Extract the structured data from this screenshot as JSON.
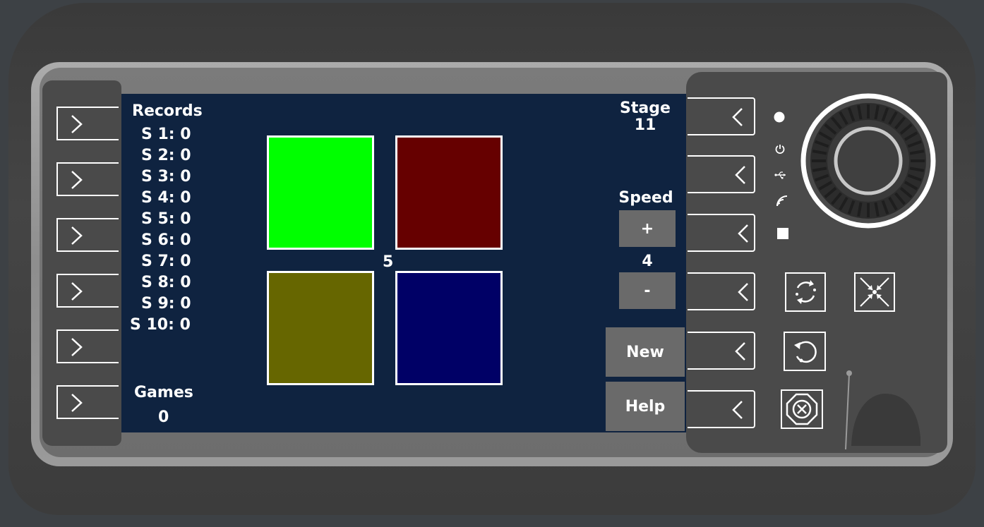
{
  "records": {
    "title": "Records",
    "items": [
      "S 1: 0",
      "S 2: 0",
      "S 3: 0",
      "S 4: 0",
      "S 5: 0",
      "S 6: 0",
      "S 7: 0",
      "S 8: 0",
      "S 9: 0",
      "S 10: 0"
    ]
  },
  "games": {
    "title": "Games",
    "value": "0"
  },
  "board": {
    "center_value": "5",
    "tiles": [
      {
        "name": "green",
        "color": "#00ff00"
      },
      {
        "name": "red",
        "color": "#660000"
      },
      {
        "name": "yellow",
        "color": "#666600"
      },
      {
        "name": "blue",
        "color": "#000066"
      }
    ]
  },
  "stage": {
    "title": "Stage",
    "value": "11"
  },
  "speed": {
    "title": "Speed",
    "plus_label": "+",
    "value": "4",
    "minus_label": "-"
  },
  "actions": {
    "new_label": "New",
    "help_label": "Help"
  },
  "status_icons": [
    "dot-icon",
    "power-icon",
    "usb-icon",
    "wifi-icon",
    "stop-icon"
  ],
  "colors": {
    "screen": "#0f2340",
    "button": "#6a6a6a",
    "panel": "#4a4a4a"
  }
}
